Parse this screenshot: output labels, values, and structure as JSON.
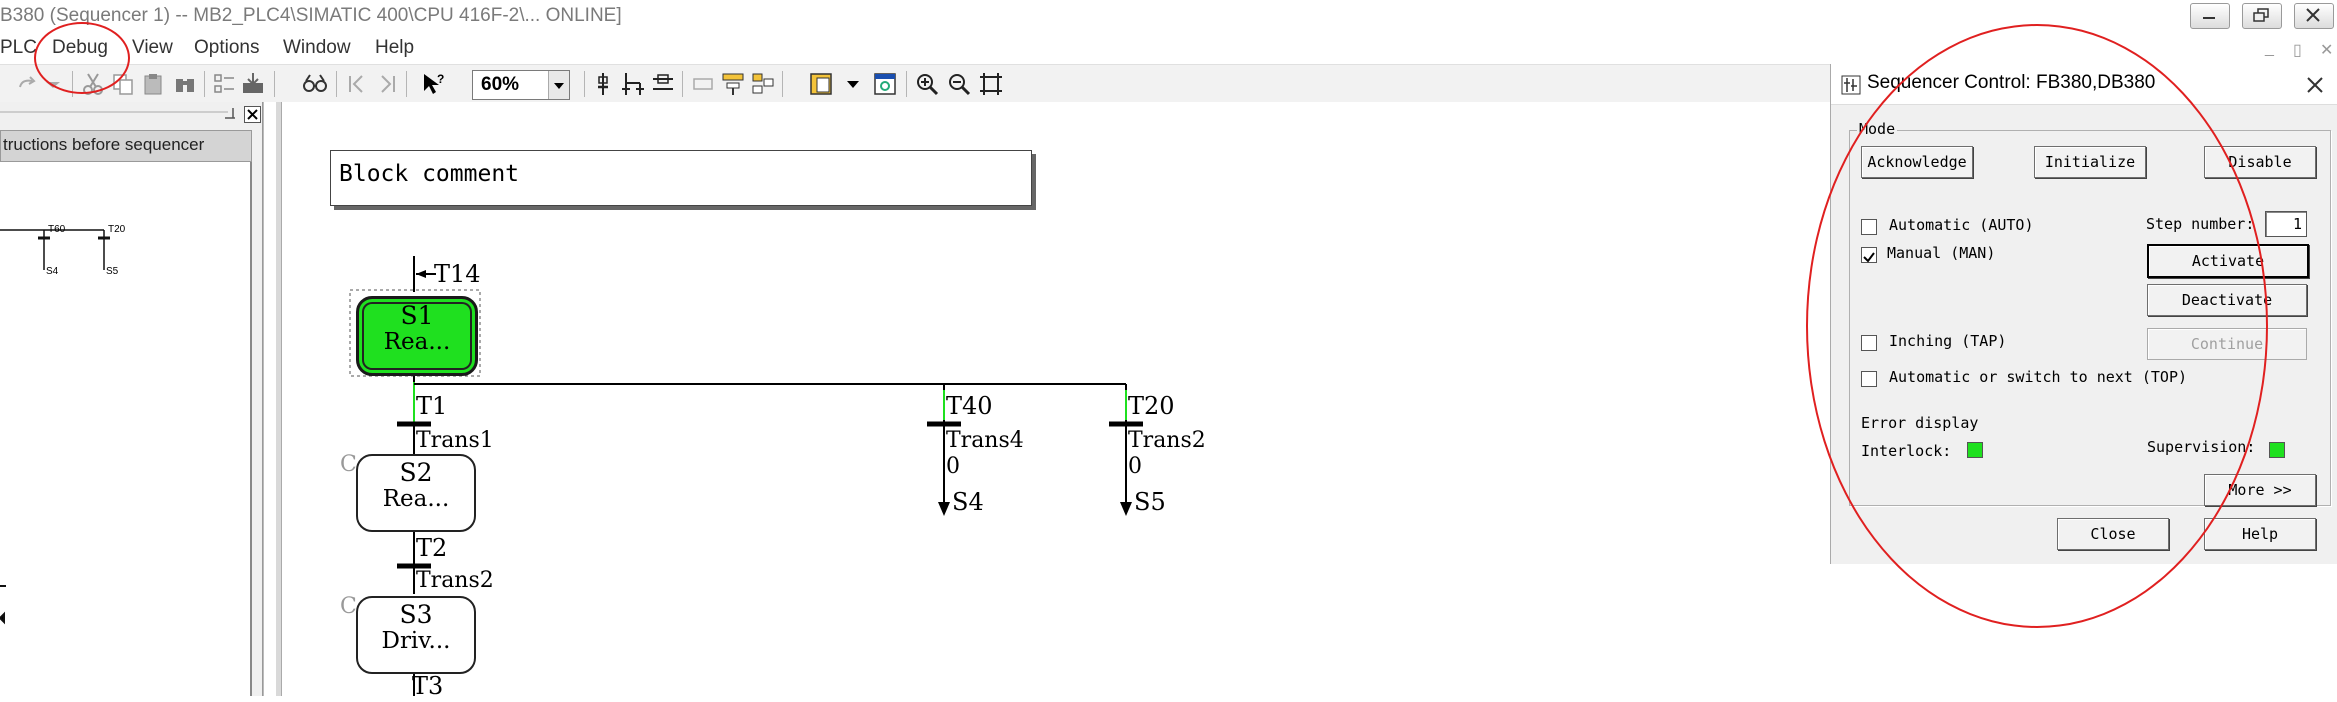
{
  "window": {
    "title": "B380 (Sequencer 1) -- MB2_PLC4\\SIMATIC 400\\CPU 416F-2\\...  ONLINE]"
  },
  "menu": {
    "items": [
      "PLC",
      "Debug",
      "View",
      "Options",
      "Window",
      "Help"
    ]
  },
  "toolbar": {
    "zoom": "60%"
  },
  "left_pane": {
    "header": "tructions before sequencer",
    "mini_labels": [
      "T60",
      "T20",
      "S4",
      "S5"
    ]
  },
  "editor": {
    "block_comment": "Block comment",
    "initial_transition": "T14",
    "steps": [
      {
        "name": "S1",
        "desc": "Rea...",
        "active": true
      },
      {
        "name": "S2",
        "desc": "Rea...",
        "active": false
      },
      {
        "name": "S3",
        "desc": "Driv...",
        "active": false
      }
    ],
    "transitions": [
      {
        "name": "T1",
        "sub": "Trans1"
      },
      {
        "name": "T40",
        "sub": "Trans4",
        "value": "0",
        "target": "S4"
      },
      {
        "name": "T20",
        "sub": "Trans2",
        "value": "0",
        "target": "S5"
      },
      {
        "name": "T2",
        "sub": "Trans2"
      },
      {
        "name": "T3"
      }
    ],
    "c_mark": "C"
  },
  "dialog": {
    "title": "Sequencer Control: FB380,DB380",
    "mode_label": "Mode",
    "buttons": {
      "acknowledge": "Acknowledge",
      "initialize": "Initialize",
      "disable": "Disable",
      "activate": "Activate",
      "deactivate": "Deactivate",
      "continue": "Continue",
      "more": "More >>",
      "close": "Close",
      "help": "Help"
    },
    "options": {
      "auto": "Automatic (AUTO)",
      "man": "Manual (MAN)",
      "tap": "Inching (TAP)",
      "top": "Automatic or switch to next (TOP)"
    },
    "checked": {
      "auto": false,
      "man": true,
      "tap": false,
      "top": false
    },
    "step_number_label": "Step number:",
    "step_number": "1",
    "error_display_label": "Error display",
    "interlock_label": "Interlock:",
    "supervision_label": "Supervision:",
    "led_color": "#1fe01f"
  },
  "colors": {
    "active_step": "#1fe01f",
    "annotation": "#e02020"
  }
}
